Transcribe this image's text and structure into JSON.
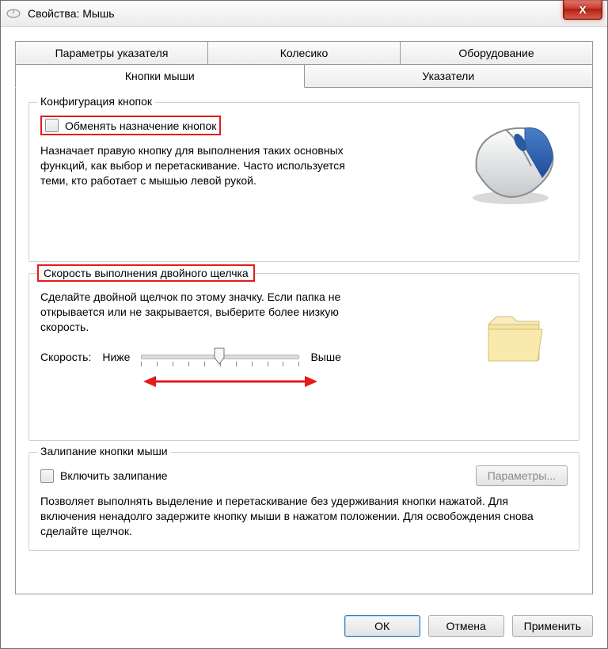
{
  "window": {
    "title": "Свойства: Мышь",
    "close_icon": "X"
  },
  "tabs": {
    "row1": [
      "Параметры указателя",
      "Колесико",
      "Оборудование"
    ],
    "row2": [
      "Кнопки мыши",
      "Указатели"
    ],
    "active": "Кнопки мыши"
  },
  "group_buttons": {
    "legend": "Конфигурация кнопок",
    "swap_label": "Обменять назначение кнопок",
    "swap_desc": "Назначает правую кнопку для выполнения таких основных функций, как выбор и перетаскивание. Часто используется теми, кто работает с мышью левой рукой."
  },
  "group_dblclick": {
    "legend": "Скорость выполнения двойного щелчка",
    "desc": "Сделайте двойной щелчок по этому значку. Если папка не открывается или не закрывается, выберите более низкую скорость.",
    "speed_label": "Скорость:",
    "slow_label": "Ниже",
    "fast_label": "Выше"
  },
  "group_clicklock": {
    "legend": "Залипание кнопки мыши",
    "enable_label": "Включить залипание",
    "params_btn": "Параметры...",
    "desc": "Позволяет выполнять выделение и перетаскивание без удерживания кнопки нажатой. Для включения ненадолго задержите кнопку мыши в нажатом положении. Для освобождения снова сделайте щелчок."
  },
  "buttons": {
    "ok": "ОК",
    "cancel": "Отмена",
    "apply": "Применить"
  }
}
